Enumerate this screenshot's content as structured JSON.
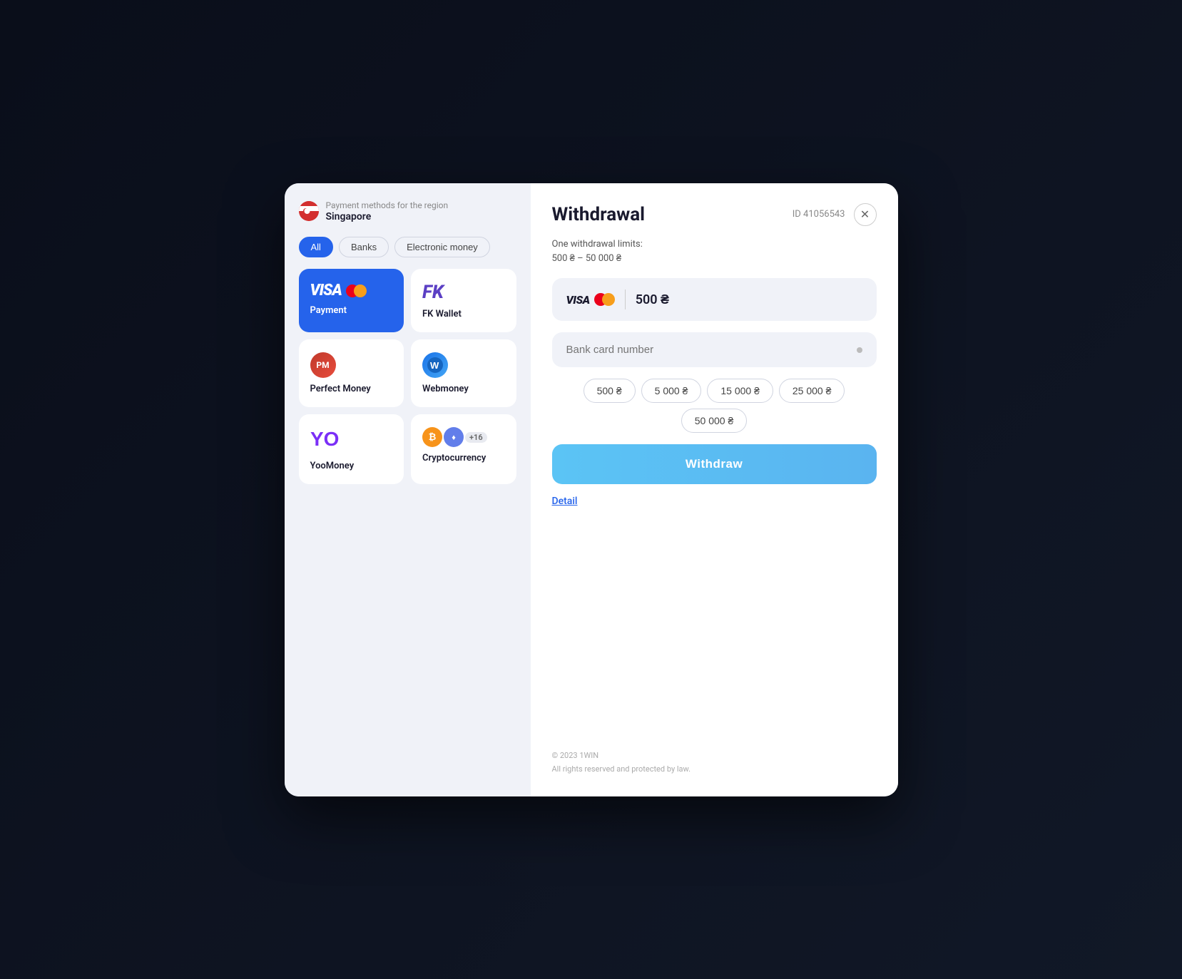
{
  "background": "#0d1117",
  "modal": {
    "left": {
      "region_label": "Payment methods for the region",
      "region_name": "Singapore",
      "filters": [
        {
          "label": "All",
          "active": true
        },
        {
          "label": "Banks",
          "active": false
        },
        {
          "label": "Electronic money",
          "active": false
        }
      ],
      "payment_methods": [
        {
          "id": "visa",
          "label": "Payment",
          "type": "visa",
          "selected": true
        },
        {
          "id": "fk_wallet",
          "label": "FK Wallet",
          "type": "fk"
        },
        {
          "id": "perfect_money",
          "label": "Perfect Money",
          "type": "pm"
        },
        {
          "id": "webmoney",
          "label": "Webmoney",
          "type": "wm"
        },
        {
          "id": "yoomoney",
          "label": "YooMoney",
          "type": "yoo"
        },
        {
          "id": "crypto",
          "label": "Cryptocurrency",
          "type": "crypto"
        }
      ]
    },
    "right": {
      "title": "Withdrawal",
      "transaction_id": "ID 41056543",
      "limits_line1": "One withdrawal limits:",
      "limits_line2": "500 ₴ – 50 000 ₴",
      "selected_amount": "500 ₴",
      "card_placeholder": "Bank card number",
      "quick_amounts": [
        "500 ₴",
        "5 000 ₴",
        "15 000 ₴",
        "25 000 ₴",
        "50 000 ₴"
      ],
      "withdraw_button": "Withdraw",
      "detail_link": "Detail",
      "footer_line1": "© 2023 1WIN",
      "footer_line2": "All rights reserved and protected by law."
    }
  }
}
